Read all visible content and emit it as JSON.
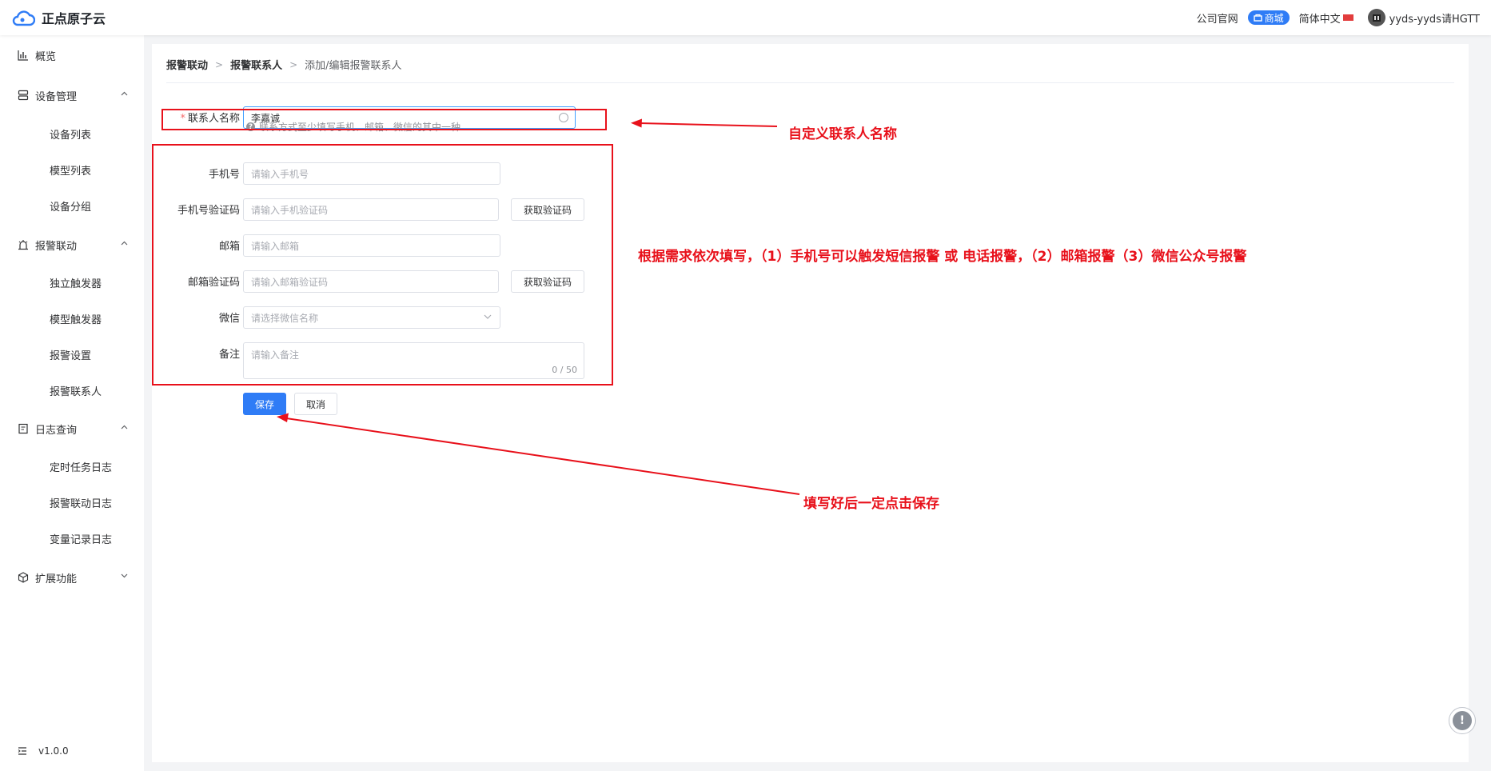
{
  "header": {
    "logo_text": "正点原子云",
    "company_site": "公司官网",
    "mall": "商城",
    "language": "简体中文",
    "user": "yyds-yyds请HGTT"
  },
  "sidebar": {
    "items": [
      {
        "label": "概览",
        "icon": "chart-icon"
      },
      {
        "label": "设备管理",
        "icon": "server-icon"
      },
      {
        "label": "报警联动",
        "icon": "alarm-icon"
      },
      {
        "label": "日志查询",
        "icon": "log-icon"
      },
      {
        "label": "扩展功能",
        "icon": "cube-icon"
      }
    ],
    "device_sub": [
      "设备列表",
      "模型列表",
      "设备分组"
    ],
    "alarm_sub": [
      "独立触发器",
      "模型触发器",
      "报警设置",
      "报警联系人"
    ],
    "log_sub": [
      "定时任务日志",
      "报警联动日志",
      "变量记录日志"
    ],
    "version": "v1.0.0"
  },
  "breadcrumb": {
    "items": [
      "报警联动",
      "报警联系人",
      "添加/编辑报警联系人"
    ]
  },
  "form": {
    "name_label": "联系人名称",
    "name_value": "李嘉诚",
    "hint": "联系方式至少填写手机、邮箱、微信的其中一种",
    "phone_label": "手机号",
    "phone_placeholder": "请输入手机号",
    "phone_code_label": "手机号验证码",
    "phone_code_placeholder": "请输入手机验证码",
    "get_code_label": "获取验证码",
    "email_label": "邮箱",
    "email_placeholder": "请输入邮箱",
    "email_code_label": "邮箱验证码",
    "email_code_placeholder": "请输入邮箱验证码",
    "wechat_label": "微信",
    "wechat_placeholder": "请选择微信名称",
    "remark_label": "备注",
    "remark_placeholder": "请输入备注",
    "remark_counter": "0 / 50",
    "save_label": "保存",
    "cancel_label": "取消"
  },
  "annotations": {
    "name_note": "自定义联系人名称",
    "contact_note": "根据需求依次填写，（1）手机号可以触发短信报警 或 电话报警，（2）邮箱报警（3）微信公众号报警",
    "save_note": "填写好后一定点击保存",
    "color": "#e8111b"
  },
  "colors": {
    "primary": "#2f7cf6",
    "required": "#f56c6c"
  }
}
